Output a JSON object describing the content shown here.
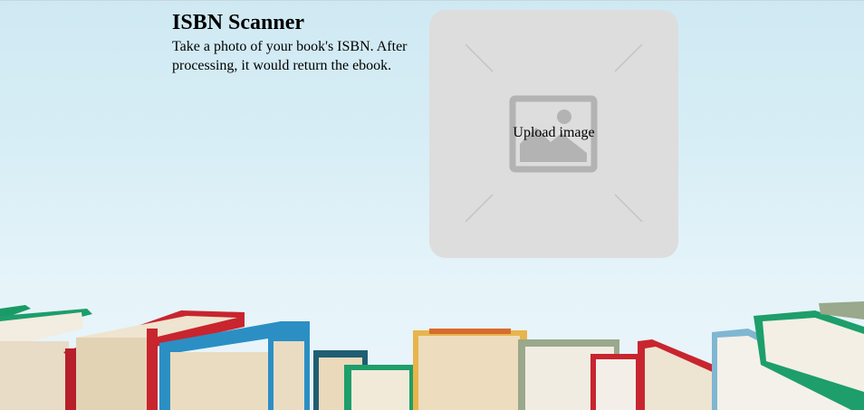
{
  "header": {
    "title": "ISBN Scanner",
    "description": "Take a photo of your book's ISBN. After processing, it would return the ebook."
  },
  "upload": {
    "label": "Upload image",
    "icon": "image-placeholder-icon"
  },
  "colors": {
    "sky": "#d9eef6",
    "upload_bg": "#dddddd",
    "placeholder_icon": "#b3b3b3"
  }
}
